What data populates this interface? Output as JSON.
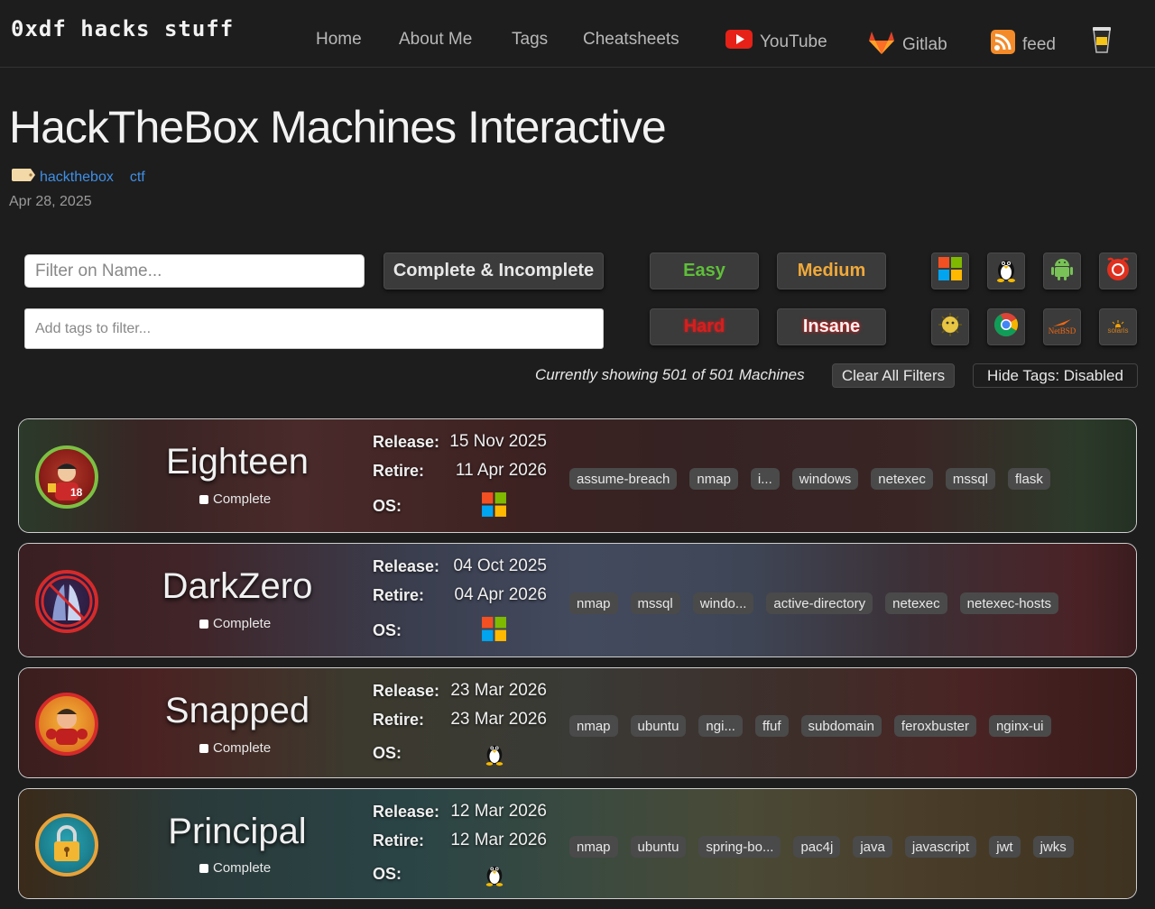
{
  "site": {
    "title": "0xdf hacks stuff"
  },
  "nav": {
    "home": "Home",
    "about": "About Me",
    "tags": "Tags",
    "cheatsheets": "Cheatsheets",
    "youtube": "YouTube",
    "gitlab": "Gitlab",
    "feed": "feed"
  },
  "page": {
    "title": "HackTheBox Machines Interactive",
    "tags": [
      "hackthebox",
      "ctf"
    ],
    "date": "Apr 28, 2025"
  },
  "filters": {
    "name_placeholder": "Filter on Name...",
    "tags_placeholder": "Add tags to filter...",
    "complete_label": "Complete & Incomplete",
    "difficulty": [
      {
        "label": "Easy",
        "color": "#5fbf3a"
      },
      {
        "label": "Medium",
        "color": "#f0a93a"
      },
      {
        "label": "Hard",
        "color": "#e02424"
      },
      {
        "label": "Insane",
        "color": "#f2f2f2"
      }
    ],
    "os_icons": [
      "windows-icon",
      "linux-icon",
      "android-icon",
      "freebsd-icon",
      "openbsd-icon",
      "chrome-icon",
      "netbsd-icon",
      "solaris-icon"
    ],
    "netbsd_text": "NetBSD",
    "solaris_text": "solaris",
    "status": "Currently showing 501 of 501 Machines",
    "clear_label": "Clear All Filters",
    "hide_tags_label": "Hide Tags: Disabled"
  },
  "labels": {
    "release": "Release:",
    "retire": "Retire:",
    "os": "OS:",
    "complete": "Complete"
  },
  "machines": [
    {
      "name": "Eighteen",
      "release": "15 Nov 2025",
      "retire": "11 Apr 2026",
      "os": "windows-icon",
      "tags": [
        "assume-breach",
        "nmap",
        "i...",
        "windows",
        "netexec",
        "mssql",
        "flask"
      ]
    },
    {
      "name": "DarkZero",
      "release": "04 Oct 2025",
      "retire": "04 Apr 2026",
      "os": "windows-icon",
      "tags": [
        "nmap",
        "mssql",
        "windo...",
        "active-directory",
        "netexec",
        "netexec-hosts"
      ]
    },
    {
      "name": "Snapped",
      "release": "23 Mar 2026",
      "retire": "23 Mar 2026",
      "os": "linux-icon",
      "tags": [
        "nmap",
        "ubuntu",
        "ngi...",
        "ffuf",
        "subdomain",
        "feroxbuster",
        "nginx-ui"
      ]
    },
    {
      "name": "Principal",
      "release": "12 Mar 2026",
      "retire": "12 Mar 2026",
      "os": "linux-icon",
      "tags": [
        "nmap",
        "ubuntu",
        "spring-bo...",
        "pac4j",
        "java",
        "javascript",
        "jwt",
        "jwks"
      ]
    }
  ]
}
